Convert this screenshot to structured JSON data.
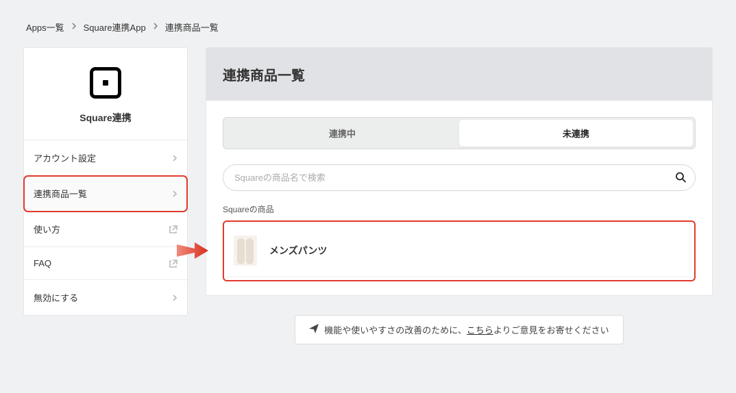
{
  "breadcrumb": {
    "items": [
      "Apps一覧",
      "Square連携App",
      "連携商品一覧"
    ]
  },
  "sidebar": {
    "title": "Square連携",
    "items": [
      {
        "label": "アカウント設定",
        "icon": "chevron"
      },
      {
        "label": "連携商品一覧",
        "icon": "chevron",
        "active": true,
        "highlighted": true
      },
      {
        "label": "使い方",
        "icon": "external"
      },
      {
        "label": "FAQ",
        "icon": "external"
      },
      {
        "label": "無効にする",
        "icon": "chevron"
      }
    ]
  },
  "panel": {
    "title": "連携商品一覧"
  },
  "tabs": {
    "items": [
      "連携中",
      "未連携"
    ],
    "active_index": 1
  },
  "search": {
    "placeholder": "Squareの商品名で検索",
    "value": ""
  },
  "products": {
    "section_label": "Squareの商品",
    "items": [
      {
        "name": "メンズパンツ"
      }
    ]
  },
  "feedback": {
    "prefix": "機能や使いやすさの改善のために、",
    "link": "こちら",
    "suffix": "よりご意見をお寄せください"
  },
  "colors": {
    "highlight": "#e03a2b",
    "page_bg": "#f0f1f3",
    "panel_header_bg": "#e1e2e5"
  }
}
